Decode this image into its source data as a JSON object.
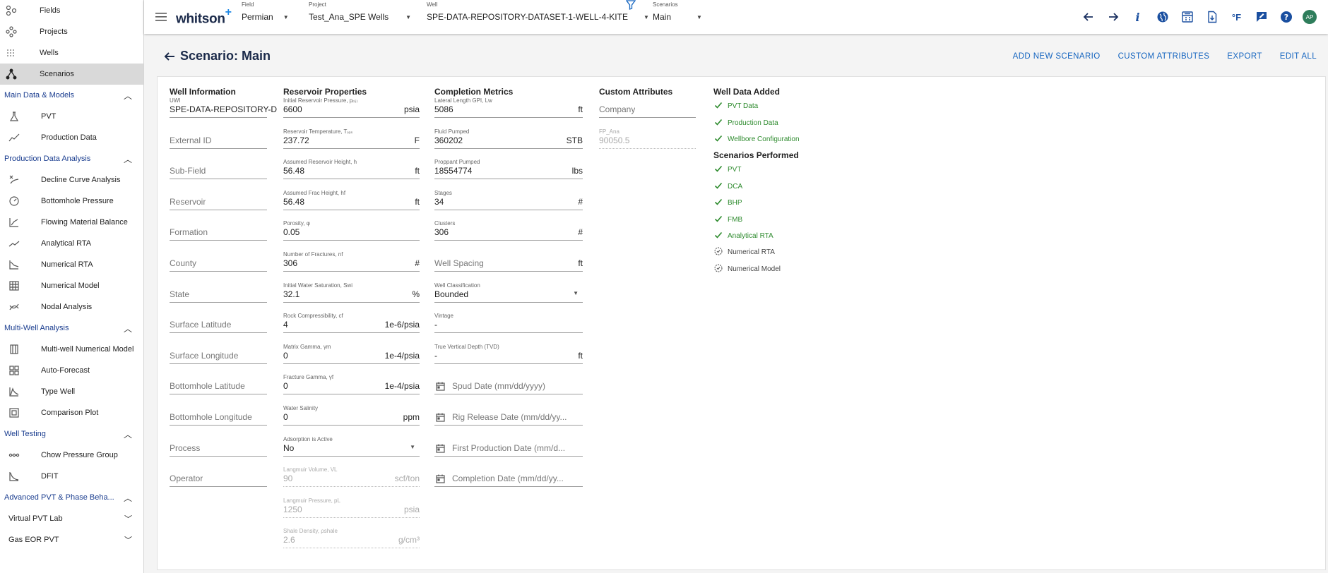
{
  "sidebar": {
    "top_items": [
      {
        "label": "Fields",
        "icon": "fields-icon"
      },
      {
        "label": "Projects",
        "icon": "projects-icon"
      },
      {
        "label": "Wells",
        "icon": "wells-icon"
      },
      {
        "label": "Scenarios",
        "icon": "scenarios-icon",
        "selected": true
      }
    ],
    "sections": [
      {
        "title": "Main Data & Models",
        "items": [
          "PVT",
          "Production Data"
        ]
      },
      {
        "title": "Production Data Analysis",
        "items": [
          "Decline Curve Analysis",
          "Bottomhole Pressure",
          "Flowing Material Balance",
          "Analytical RTA",
          "Numerical RTA",
          "Numerical Model",
          "Nodal Analysis"
        ]
      },
      {
        "title": "Multi-Well Analysis",
        "items": [
          "Multi-well Numerical Model",
          "Auto-Forecast",
          "Type Well",
          "Comparison Plot"
        ]
      },
      {
        "title": "Well Testing",
        "items": [
          "Chow Pressure Group",
          "DFIT"
        ]
      },
      {
        "title": "Advanced PVT & Phase Beha..."
      }
    ],
    "groups": [
      "Virtual PVT Lab",
      "Gas EOR PVT"
    ]
  },
  "topbar": {
    "logo": "whitson",
    "logo_plus": "+",
    "field": {
      "label": "Field",
      "value": "Permian"
    },
    "project": {
      "label": "Project",
      "value": "Test_Ana_SPE Wells"
    },
    "well": {
      "label": "Well",
      "value": "SPE-DATA-REPOSITORY-DATASET-1-WELL-4-KITE"
    },
    "scenarios": {
      "label": "Scenarios",
      "value": "Main"
    },
    "info_glyph": "i",
    "unit_glyph": "°F",
    "avatar": "AP"
  },
  "page": {
    "title": "Scenario: Main",
    "actions": [
      "ADD NEW SCENARIO",
      "CUSTOM ATTRIBUTES",
      "EXPORT",
      "EDIT ALL"
    ]
  },
  "well_info": {
    "title": "Well Information",
    "uwi_label": "UWI",
    "uwi_value": "SPE-DATA-REPOSITORY-D",
    "placeholders": [
      "External ID",
      "Sub-Field",
      "Reservoir",
      "Formation",
      "County",
      "State",
      "Surface Latitude",
      "Surface Longitude",
      "Bottomhole Latitude",
      "Bottomhole Longitude",
      "Process",
      "Operator"
    ]
  },
  "reservoir": {
    "title": "Reservoir Properties",
    "fields": [
      {
        "label": "Initial Reservoir Pressure, pᵣ₍ᵢ₎",
        "value": "6600",
        "unit": "psia"
      },
      {
        "label": "Reservoir Temperature, Tᵣₑₛ",
        "value": "237.72",
        "unit": "F"
      },
      {
        "label": "Assumed Reservoir Height, h",
        "value": "56.48",
        "unit": "ft"
      },
      {
        "label": "Assumed Frac Height, hf",
        "value": "56.48",
        "unit": "ft"
      },
      {
        "label": "Porosity, φ",
        "value": "0.05",
        "unit": ""
      },
      {
        "label": "Number of Fractures, nf",
        "value": "306",
        "unit": "#"
      },
      {
        "label": "Initial Water Saturation, Swi",
        "value": "32.1",
        "unit": "%"
      },
      {
        "label": "Rock Compressibility, cf",
        "value": "4",
        "unit": "1e-6/psia"
      },
      {
        "label": "Matrix Gamma, γm",
        "value": "0",
        "unit": "1e-4/psia"
      },
      {
        "label": "Fracture Gamma, γf",
        "value": "0",
        "unit": "1e-4/psia"
      },
      {
        "label": "Water Salinity",
        "value": "0",
        "unit": "ppm"
      }
    ],
    "adsorption": {
      "label": "Adsorption is Active",
      "value": "No"
    },
    "disabled_fields": [
      {
        "label": "Langmuir Volume, VL",
        "value": "90",
        "unit": "scf/ton"
      },
      {
        "label": "Langmuir Pressure, pL",
        "value": "1250",
        "unit": "psia"
      },
      {
        "label": "Shale Density, ρshale",
        "value": "2.6",
        "unit": "g/cm³"
      }
    ]
  },
  "completion": {
    "title": "Completion Metrics",
    "fields": [
      {
        "label": "Lateral Length GPI, Lw",
        "value": "5086",
        "unit": "ft"
      },
      {
        "label": "Fluid Pumped",
        "value": "360202",
        "unit": "STB"
      },
      {
        "label": "Proppant Pumped",
        "value": "18554774",
        "unit": "lbs"
      },
      {
        "label": "Stages",
        "value": "34",
        "unit": "#"
      },
      {
        "label": "Clusters",
        "value": "306",
        "unit": "#"
      }
    ],
    "well_spacing": {
      "placeholder": "Well Spacing",
      "unit": "ft"
    },
    "classification": {
      "label": "Well Classification",
      "value": "Bounded"
    },
    "vintage": {
      "label": "Vintage",
      "value": "-"
    },
    "tvd": {
      "label": "True Vertical Depth (TVD)",
      "value": "-",
      "unit": "ft"
    },
    "dates": [
      "Spud Date (mm/dd/yyyy)",
      "Rig Release Date (mm/dd/yy...",
      "First Production Date (mm/d...",
      "Completion Date (mm/dd/yy..."
    ]
  },
  "custom": {
    "title": "Custom Attributes",
    "company_placeholder": "Company",
    "fp_label": "FP_Ana",
    "fp_value": "90050.5"
  },
  "well_data": {
    "title": "Well Data Added",
    "items": [
      "PVT Data",
      "Production Data",
      "Wellbore Configuration"
    ],
    "scenarios_title": "Scenarios Performed",
    "done": [
      "PVT",
      "DCA",
      "BHP",
      "FMB",
      "Analytical RTA"
    ],
    "pending": [
      "Numerical RTA",
      "Numerical Model"
    ]
  },
  "colors": {
    "accent": "#1565c0",
    "success": "#2e8b2e",
    "selected": "#d9d9d9"
  }
}
